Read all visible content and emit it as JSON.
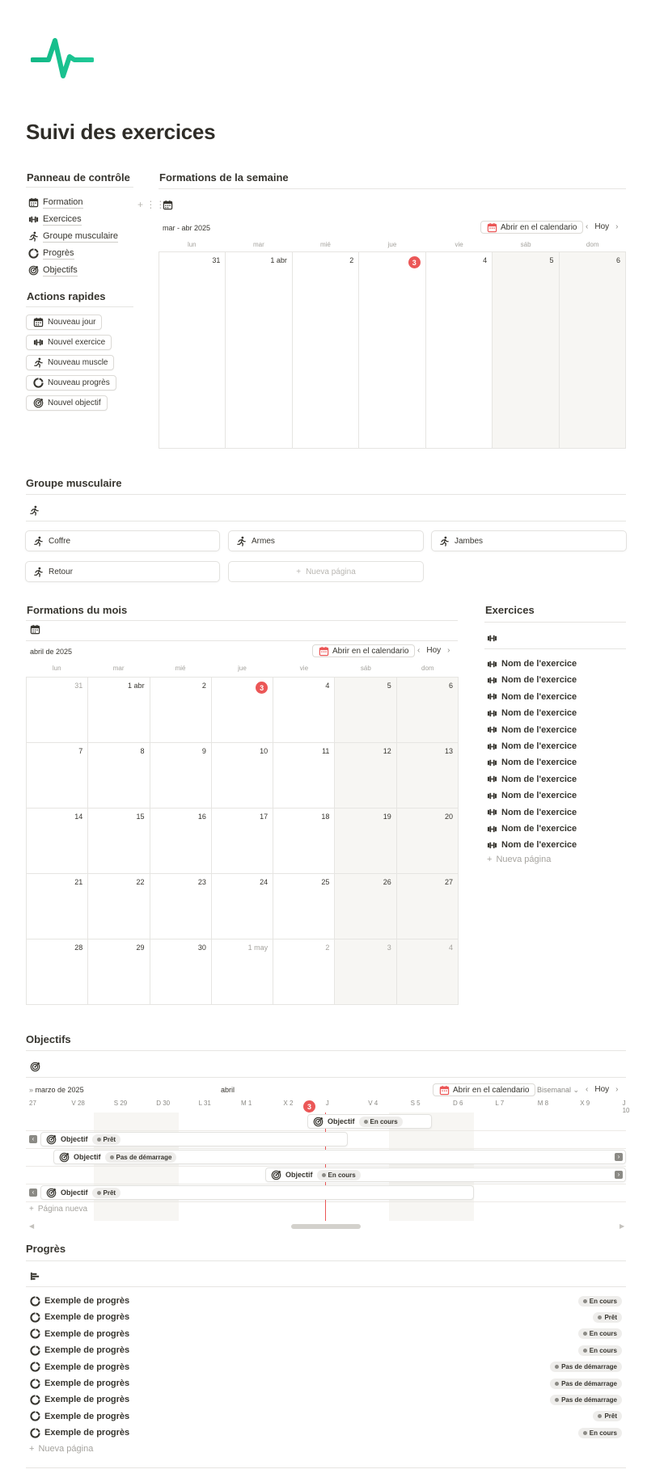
{
  "page": {
    "title": "Suivi des exercices"
  },
  "sidebar": {
    "heading": "Panneau de contrôle",
    "items": [
      {
        "label": "Formation",
        "icon": "calendar-icon"
      },
      {
        "label": "Exercices",
        "icon": "dumbbell-icon"
      },
      {
        "label": "Groupe musculaire",
        "icon": "runner-icon"
      },
      {
        "label": "Progrès",
        "icon": "progress-icon"
      },
      {
        "label": "Objectifs",
        "icon": "target-icon"
      }
    ],
    "quick_heading": "Actions rapides",
    "quick": [
      {
        "label": "Nouveau jour",
        "icon": "calendar-icon"
      },
      {
        "label": "Nouvel exercice",
        "icon": "dumbbell-icon"
      },
      {
        "label": "Nouveau muscle",
        "icon": "runner-icon"
      },
      {
        "label": "Nouveau progrès",
        "icon": "progress-icon"
      },
      {
        "label": "Nouvel objectif",
        "icon": "target-icon"
      }
    ]
  },
  "week": {
    "heading": "Formations de la semaine",
    "range": "mar - abr 2025",
    "open_cal": "Abrir en el calendario",
    "today": "Hoy",
    "dow": [
      "lun",
      "mar",
      "mié",
      "jue",
      "vie",
      "sáb",
      "dom"
    ],
    "days": [
      "31",
      "1 abr",
      "2",
      "3",
      "4",
      "5",
      "6"
    ]
  },
  "muscle": {
    "heading": "Groupe musculaire",
    "cards": [
      "Coffre",
      "Armes",
      "Jambes",
      "Retour"
    ],
    "new_page": "Nueva página"
  },
  "month": {
    "heading": "Formations du mois",
    "label": "abril de 2025",
    "open_cal": "Abrir en el calendario",
    "today": "Hoy",
    "dow": [
      "lun",
      "mar",
      "mié",
      "jue",
      "vie",
      "sáb",
      "dom"
    ],
    "weeks": [
      [
        "31",
        "1 abr",
        "2",
        "3",
        "4",
        "5",
        "6"
      ],
      [
        "7",
        "8",
        "9",
        "10",
        "11",
        "12",
        "13"
      ],
      [
        "14",
        "15",
        "16",
        "17",
        "18",
        "19",
        "20"
      ],
      [
        "21",
        "22",
        "23",
        "24",
        "25",
        "26",
        "27"
      ],
      [
        "28",
        "29",
        "30",
        "1 may",
        "2",
        "3",
        "4"
      ]
    ]
  },
  "exercises": {
    "heading": "Exercices",
    "items": [
      "Nom de l'exercice",
      "Nom de l'exercice",
      "Nom de l'exercice",
      "Nom de l'exercice",
      "Nom de l'exercice",
      "Nom de l'exercice",
      "Nom de l'exercice",
      "Nom de l'exercice",
      "Nom de l'exercice",
      "Nom de l'exercice",
      "Nom de l'exercice",
      "Nom de l'exercice"
    ],
    "new_page": "Nueva página"
  },
  "objectives": {
    "heading": "Objectifs",
    "month1": "marzo de 2025",
    "month2": "abril",
    "open_cal": "Abrir en el calendario",
    "view": "Bisemanal",
    "today": "Hoy",
    "days": [
      "27",
      "V 28",
      "S 29",
      "D 30",
      "L 31",
      "M 1",
      "X 2",
      "J",
      "V 4",
      "S 5",
      "D 6",
      "L 7",
      "M 8",
      "X 9",
      "J 10"
    ],
    "today_num": "3",
    "bars": [
      {
        "label": "Objectif",
        "status": "En cours"
      },
      {
        "label": "Objectif",
        "status": "Prêt"
      },
      {
        "label": "Objectif",
        "status": "Pas de démarrage"
      },
      {
        "label": "Objectif",
        "status": "En cours"
      },
      {
        "label": "Objectif",
        "status": "Prêt"
      }
    ],
    "new_page": "Página nueva"
  },
  "progress": {
    "heading": "Progrès",
    "items": [
      {
        "label": "Exemple de progrès",
        "status": "En cours"
      },
      {
        "label": "Exemple de progrès",
        "status": "Prêt"
      },
      {
        "label": "Exemple de progrès",
        "status": "En cours"
      },
      {
        "label": "Exemple de progrès",
        "status": "En cours"
      },
      {
        "label": "Exemple de progrès",
        "status": "Pas de démarrage"
      },
      {
        "label": "Exemple de progrès",
        "status": "Pas de démarrage"
      },
      {
        "label": "Exemple de progrès",
        "status": "Pas de démarrage"
      },
      {
        "label": "Exemple de progrès",
        "status": "Prêt"
      },
      {
        "label": "Exemple de progrès",
        "status": "En cours"
      }
    ],
    "new_page": "Nueva página"
  },
  "colors": {
    "accent": "#eb5757",
    "logo": "#1cc48a"
  }
}
